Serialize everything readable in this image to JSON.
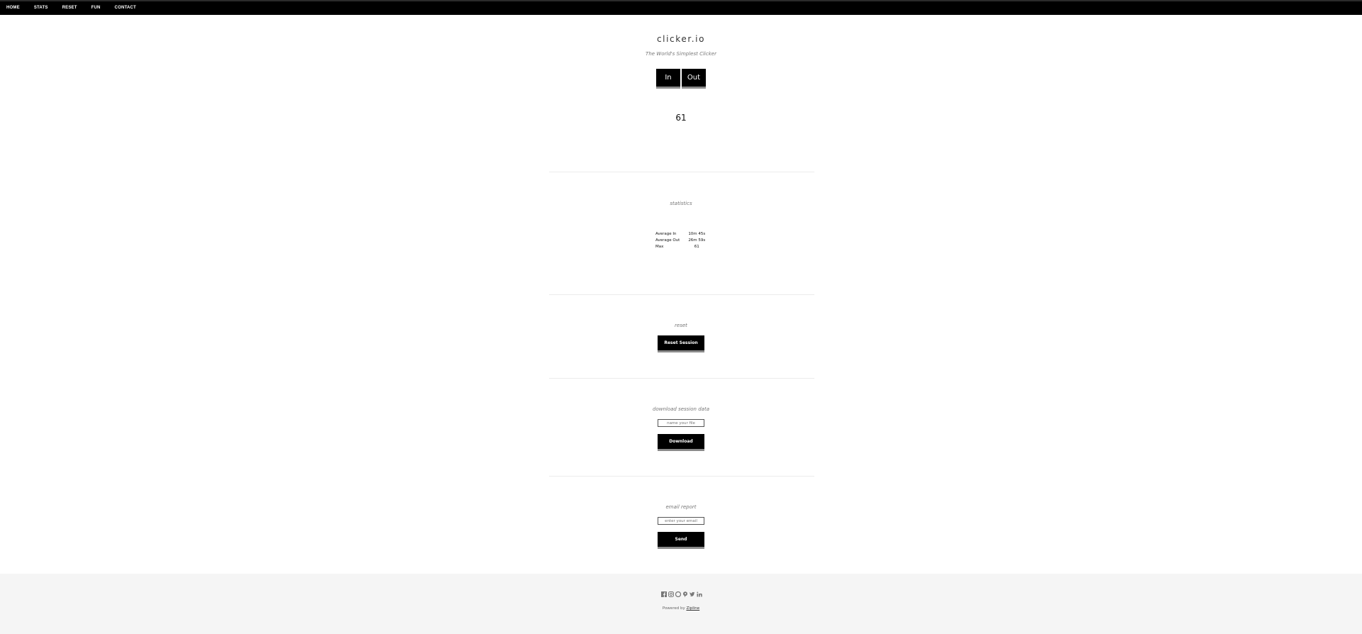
{
  "nav": {
    "items": [
      "HOME",
      "STATS",
      "RESET",
      "FUN",
      "CONTACT"
    ]
  },
  "hero": {
    "title": "clicker.io",
    "subtitle": "The World's Simplest Clicker",
    "in_label": "In",
    "out_label": "Out",
    "count": "61"
  },
  "statistics": {
    "label": "statistics",
    "rows": [
      {
        "name": "Average In",
        "value": "10m 45s"
      },
      {
        "name": "Average Out",
        "value": "26m 59s"
      },
      {
        "name": "Max",
        "value": "61"
      }
    ]
  },
  "reset": {
    "label": "reset",
    "button": "Reset Session"
  },
  "download": {
    "label": "download session data",
    "placeholder": "name your file",
    "button": "Download"
  },
  "email": {
    "label": "email report",
    "placeholder": "enter your email",
    "button": "Send"
  },
  "footer": {
    "powered_prefix": "Powered by",
    "powered_link": "Zipline",
    "social_icons": [
      "facebook-icon",
      "instagram-icon",
      "github-icon",
      "pinterest-icon",
      "twitter-icon",
      "linkedin-icon"
    ]
  }
}
